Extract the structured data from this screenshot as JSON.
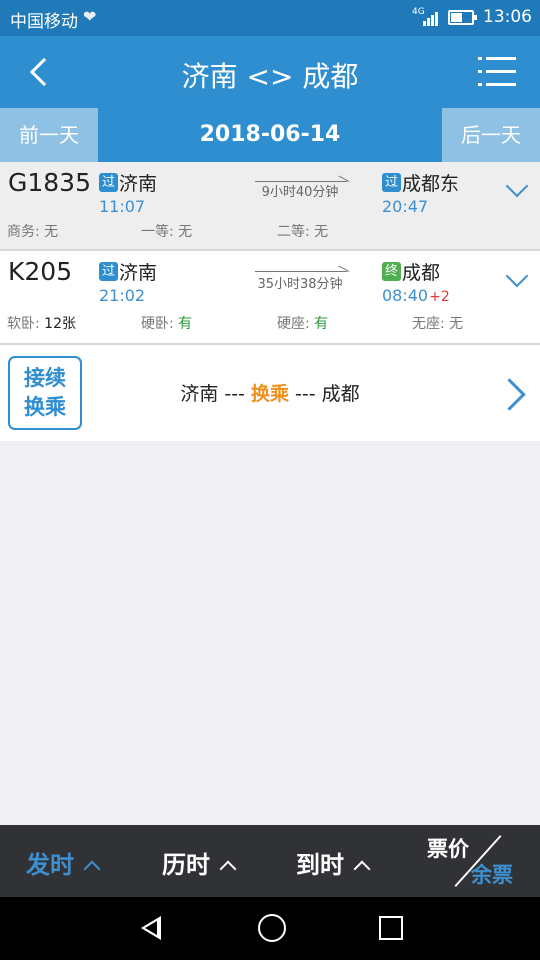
{
  "status_bar": {
    "carrier": "中国移动",
    "network": "4G",
    "time": "13:06",
    "icons": [
      "heart-pulse-icon",
      "signal-icon",
      "battery-icon"
    ]
  },
  "header": {
    "title": "济南 <> 成都",
    "back_icon": "chevron-left-icon",
    "menu_icon": "list-menu-icon"
  },
  "date_bar": {
    "prev_label": "前一天",
    "date": "2018-06-14",
    "next_label": "后一天"
  },
  "trains": [
    {
      "code": "G1835",
      "from_badge": "过",
      "from_station": "济南",
      "depart_time": "11:07",
      "duration": "9小时40分钟",
      "to_badge": "过",
      "to_station": "成都东",
      "arrive_time": "20:47",
      "arrive_offset": "",
      "seats": [
        {
          "label": "商务:",
          "value": "无"
        },
        {
          "label": "一等:",
          "value": "无"
        },
        {
          "label": "二等:",
          "value": "无"
        }
      ]
    },
    {
      "code": "K205",
      "from_badge": "过",
      "from_station": "济南",
      "depart_time": "21:02",
      "duration": "35小时38分钟",
      "to_badge": "终",
      "to_station": "成都",
      "arrive_time": "08:40",
      "arrive_offset": "+2",
      "seats": [
        {
          "label": "软卧:",
          "value": "12张"
        },
        {
          "label": "硬卧:",
          "value": "有"
        },
        {
          "label": "硬座:",
          "value": "有"
        },
        {
          "label": "无座:",
          "value": "无"
        }
      ]
    }
  ],
  "transfer": {
    "tag_line1": "接续",
    "tag_line2": "换乘",
    "from": "济南",
    "sep1": " --- ",
    "middle": "换乘",
    "sep2": " --- ",
    "to": "成都"
  },
  "sort_bar": {
    "depart": "发时",
    "duration": "历时",
    "arrive": "到时",
    "price": "票价",
    "remaining": "余票",
    "active": "depart"
  },
  "colors": {
    "primary": "#2e8ed0",
    "link": "#3d8fd0",
    "available": "#2e9b3a",
    "highlight": "#f0901e",
    "delta": "#e53935"
  }
}
